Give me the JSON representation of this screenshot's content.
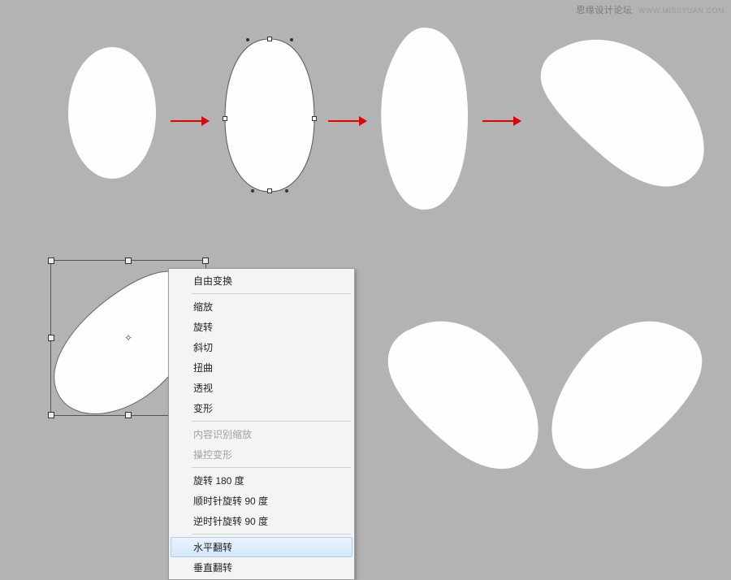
{
  "watermark": {
    "main": "思缘设计论坛",
    "sub": "WWW.MISSYUAN.COM"
  },
  "menu": {
    "free_transform": "自由变换",
    "scale": "缩放",
    "rotate": "旋转",
    "skew": "斜切",
    "distort": "扭曲",
    "perspective": "透视",
    "warp": "变形",
    "content_aware_scale": "内容识别缩放",
    "puppet_warp": "操控变形",
    "rotate_180": "旋转 180 度",
    "rotate_cw_90": "顺时针旋转 90 度",
    "rotate_ccw_90": "逆时针旋转 90 度",
    "flip_horizontal": "水平翻转",
    "flip_vertical": "垂直翻转"
  },
  "icons": {
    "pivot": "✧"
  }
}
